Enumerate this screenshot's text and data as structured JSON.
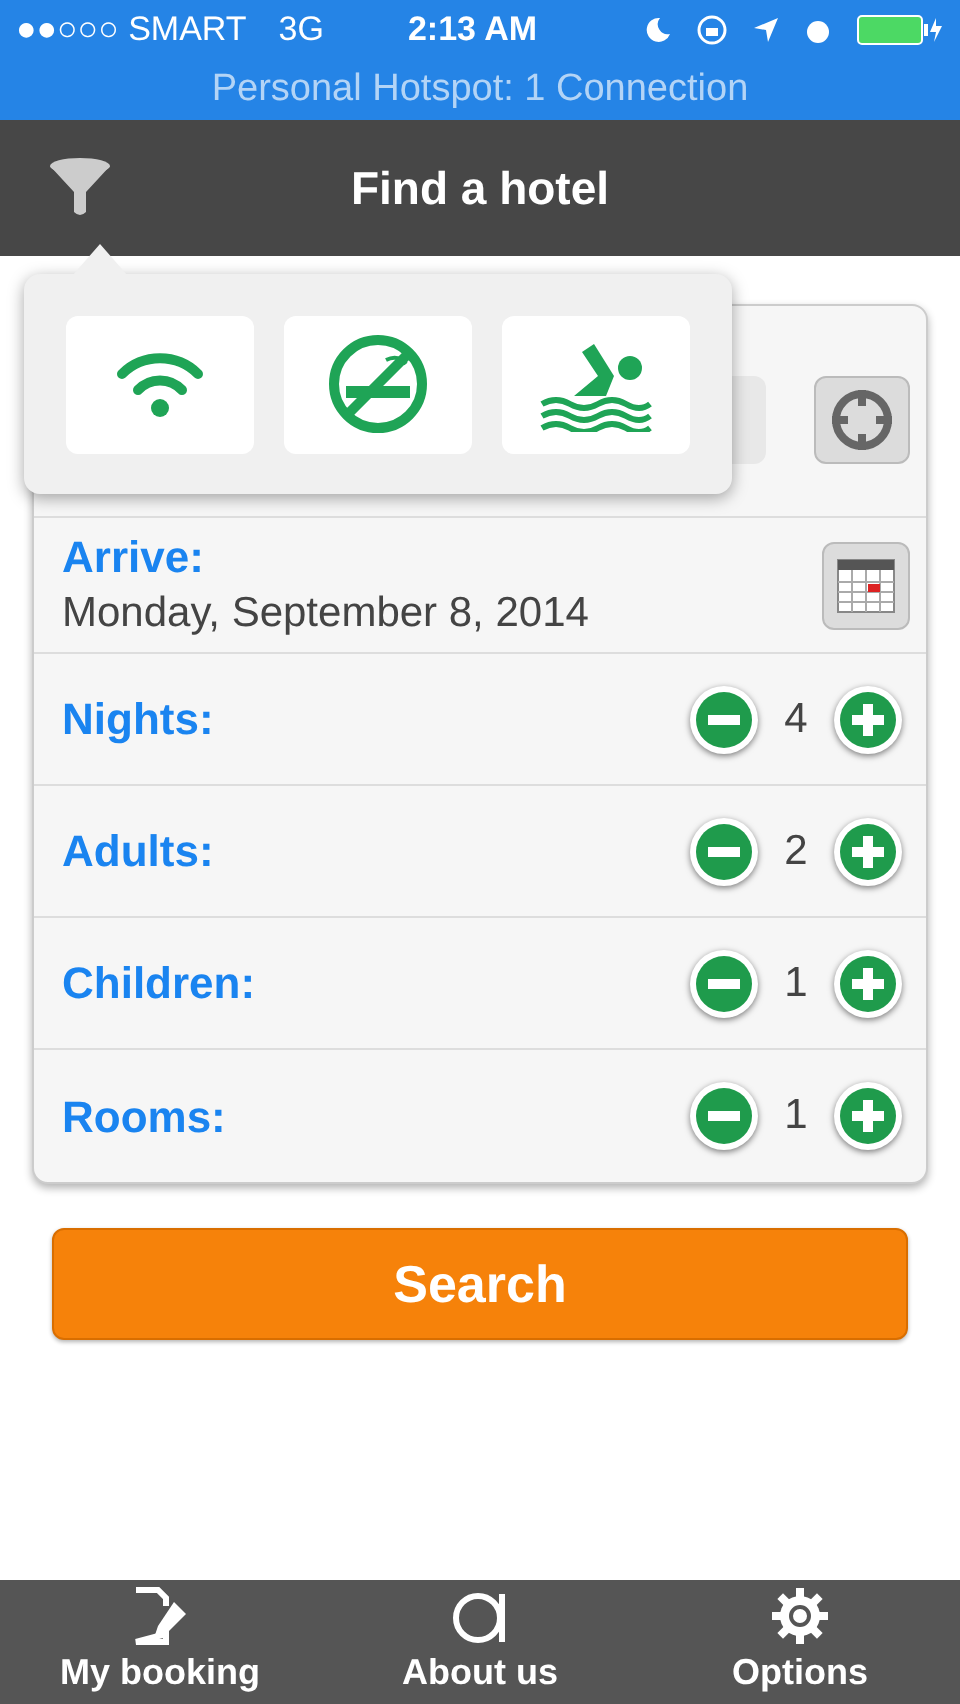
{
  "status_bar": {
    "carrier": "●●○○○ SMART",
    "network": "3G",
    "time": "2:13 AM"
  },
  "hotspot_banner": "Personal Hotspot: 1 Connection",
  "nav": {
    "title": "Find a hotel"
  },
  "filters": [
    {
      "kind": "wifi"
    },
    {
      "kind": "no-smoking"
    },
    {
      "kind": "pool"
    }
  ],
  "arrive": {
    "label": "Arrive:",
    "value": "Monday, September 8, 2014"
  },
  "counters": [
    {
      "label": "Nights:",
      "value": "4"
    },
    {
      "label": "Adults:",
      "value": "2"
    },
    {
      "label": "Children:",
      "value": "1"
    },
    {
      "label": "Rooms:",
      "value": "1"
    }
  ],
  "search_button": "Search",
  "tab_bar": [
    {
      "kind": "booking",
      "label": "My booking"
    },
    {
      "kind": "about",
      "label": "About us"
    },
    {
      "kind": "options",
      "label": "Options"
    }
  ]
}
